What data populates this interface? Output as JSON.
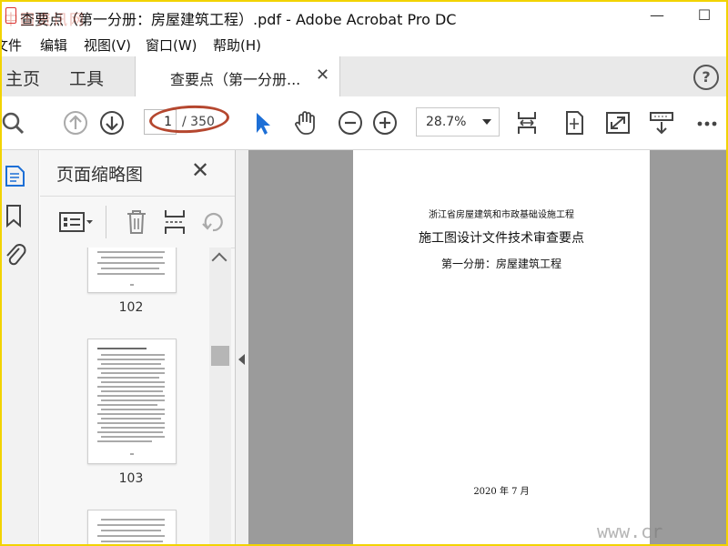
{
  "window": {
    "title": "查要点（第一分册：房屋建筑工程）.pdf - Adobe Acrobat Pro DC",
    "minimize": "—",
    "maximize": "☐"
  },
  "menu": [
    "文件",
    "编辑",
    "视图(V)",
    "窗口(W)",
    "帮助(H)"
  ],
  "tabs": {
    "home": "主页",
    "tools": "工具",
    "document": "查要点（第一分册...",
    "close": "✕",
    "help": "?"
  },
  "toolbar": {
    "page_current": "1",
    "page_total": "/ 350",
    "zoom": "28.7%"
  },
  "panel": {
    "title": "页面缩略图",
    "close": "✕",
    "thumbnails": [
      {
        "label": "102"
      },
      {
        "label": "103"
      },
      {
        "label": ""
      }
    ]
  },
  "document": {
    "line1": "浙江省房屋建筑和市政基础设施工程",
    "line2": "施工图设计文件技术审查要点",
    "line3": "第一分册：房屋建筑工程",
    "date": "2020 年 7 月"
  },
  "watermarks": {
    "top": "中国资讯网",
    "bottom": "www.cr"
  },
  "colors": {
    "accent_blue": "#1d6fd6",
    "highlight_ellipse": "#b5472f",
    "frame_border": "#f2d300"
  }
}
